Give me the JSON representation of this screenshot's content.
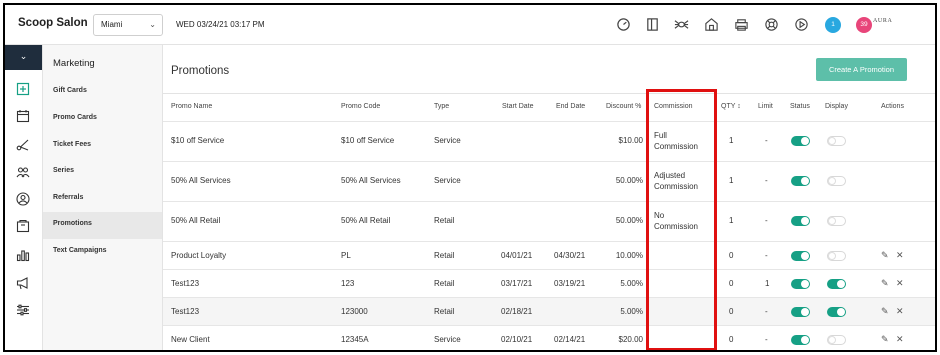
{
  "topbar": {
    "brand": "Scoop Salon",
    "location": "Miami",
    "datetime": "WED 03/24/21  03:17 PM",
    "badge_blue": "1",
    "badge_pink": "39",
    "account": "AURA",
    "icons": [
      "gauge-icon",
      "book-icon",
      "spider-icon",
      "house-icon",
      "printer-icon",
      "lifebuoy-icon",
      "play-icon"
    ]
  },
  "menu": {
    "title": "Marketing",
    "items": [
      {
        "label": "Gift Cards"
      },
      {
        "label": "Promo Cards"
      },
      {
        "label": "Ticket Fees"
      },
      {
        "label": "Series"
      },
      {
        "label": "Referrals"
      },
      {
        "label": "Promotions"
      },
      {
        "label": "Text Campaigns"
      }
    ]
  },
  "main": {
    "title": "Promotions",
    "create_button": "Create A Promotion",
    "columns": {
      "promo_name": "Promo Name",
      "promo_code": "Promo Code",
      "type": "Type",
      "start_date": "Start Date",
      "end_date": "End Date",
      "discount": "Discount %",
      "commission": "Commission",
      "qty": "QTY",
      "limit": "Limit",
      "status": "Status",
      "display": "Display",
      "actions": "Actions"
    },
    "qty_sort_icon": "↕",
    "rows": [
      {
        "name": "$10 off Service",
        "code": "$10 off Service",
        "type": "Service",
        "start": "",
        "end": "",
        "discount": "$10.00",
        "commission_1": "Full",
        "commission_2": "Commission",
        "qty": "1",
        "limit": "-",
        "status": true,
        "display": false,
        "actions": false
      },
      {
        "name": "50% All Services",
        "code": "50% All Services",
        "type": "Service",
        "start": "",
        "end": "",
        "discount": "50.00%",
        "commission_1": "Adjusted",
        "commission_2": "Commission",
        "qty": "1",
        "limit": "-",
        "status": true,
        "display": false,
        "actions": false
      },
      {
        "name": "50% All Retail",
        "code": "50% All Retail",
        "type": "Retail",
        "start": "",
        "end": "",
        "discount": "50.00%",
        "commission_1": "No",
        "commission_2": "Commission",
        "qty": "1",
        "limit": "-",
        "status": true,
        "display": false,
        "actions": false
      },
      {
        "name": "Product Loyalty",
        "code": "PL",
        "type": "Retail",
        "start": "04/01/21",
        "end": "04/30/21",
        "discount": "10.00%",
        "commission_1": "",
        "commission_2": "",
        "qty": "0",
        "limit": "-",
        "status": true,
        "display": false,
        "actions": true
      },
      {
        "name": "Test123",
        "code": "123",
        "type": "Retail",
        "start": "03/17/21",
        "end": "03/19/21",
        "discount": "5.00%",
        "commission_1": "",
        "commission_2": "",
        "qty": "0",
        "limit": "1",
        "status": true,
        "display": true,
        "actions": true
      },
      {
        "name": "Test123",
        "code": "123000",
        "type": "Retail",
        "start": "02/18/21",
        "end": "",
        "discount": "5.00%",
        "commission_1": "",
        "commission_2": "",
        "qty": "0",
        "limit": "-",
        "status": true,
        "display": true,
        "actions": true
      },
      {
        "name": "New Client",
        "code": "12345A",
        "type": "Service",
        "start": "02/10/21",
        "end": "02/14/21",
        "discount": "$20.00",
        "commission_1": "",
        "commission_2": "",
        "qty": "0",
        "limit": "-",
        "status": true,
        "display": false,
        "actions": true
      }
    ],
    "edit_glyph": "✎",
    "delete_glyph": "✕"
  },
  "colors": {
    "accent": "#5dbfa9",
    "toggle_on": "#16a085",
    "highlight": "#e01010",
    "rail_top": "#1f2d3d",
    "badge_blue": "#29a8e0",
    "badge_pink": "#e8457a"
  }
}
